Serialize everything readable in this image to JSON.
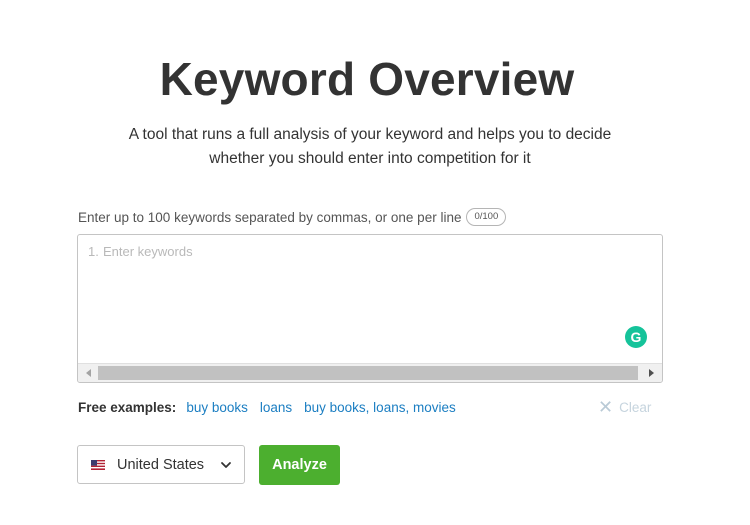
{
  "header": {
    "title": "Keyword Overview",
    "subtitle_line1": "A tool that runs a full analysis of your keyword and helps you to decide",
    "subtitle_line2": "whether you should enter into competition for it"
  },
  "keywords_input": {
    "label": "Enter up to 100 keywords separated by commas, or one per line",
    "counter": "0/100",
    "line_number": "1.",
    "placeholder": "Enter keywords",
    "value": "",
    "grammarly_badge": "G"
  },
  "examples": {
    "label": "Free examples:",
    "links": [
      "buy books",
      "loans",
      "buy books, loans, movies"
    ],
    "clear_label": "Clear"
  },
  "controls": {
    "country": "United States",
    "analyze_label": "Analyze"
  },
  "icons": {
    "flag": "us-flag-icon",
    "dropdown": "chevron-down-icon",
    "clear": "close-icon",
    "grammarly": "grammarly-icon",
    "scroll_left": "scroll-left-arrow-icon",
    "scroll_right": "scroll-right-arrow-icon"
  },
  "colors": {
    "accent_link": "#1b7ec2",
    "analyze_green": "#4caf2f",
    "grammarly_green": "#15c39a",
    "clear_disabled": "#c6d4de"
  }
}
